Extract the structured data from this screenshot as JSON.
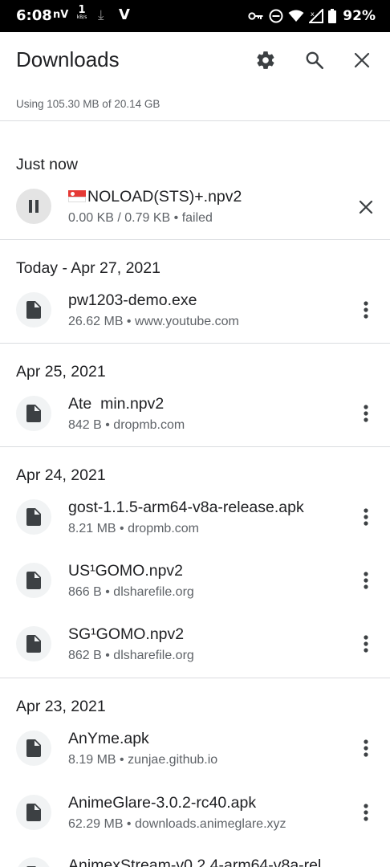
{
  "status_bar": {
    "time": "6:08",
    "carrier": "nV",
    "speed_value": "1",
    "speed_unit": "kB/s",
    "battery": "92%",
    "icons": [
      "download-icon",
      "vpn-v-icon",
      "key-icon",
      "dnd-icon",
      "wifi-icon",
      "signal-icon",
      "battery-icon"
    ]
  },
  "app_bar": {
    "title": "Downloads",
    "icons": [
      "settings-icon",
      "search-icon",
      "close-icon"
    ]
  },
  "storage": "Using 105.30 MB of 20.14 GB",
  "sections": [
    {
      "header": "Just now",
      "items": [
        {
          "name": "NOLOAD(STS)+.npv2",
          "meta": "0.00 KB / 0.79 KB • failed",
          "flag": "singapore-flag"
        }
      ]
    },
    {
      "header": "Today - Apr 27, 2021",
      "items": [
        {
          "name": "pw1203-demo.exe",
          "meta": "26.62 MB • www.youtube.com"
        }
      ]
    },
    {
      "header": "Apr 25, 2021",
      "items": [
        {
          "name": "Ate  min.npv2",
          "meta": "842 B • dropmb.com"
        }
      ]
    },
    {
      "header": "Apr 24, 2021",
      "items": [
        {
          "name": "gost-1.1.5-arm64-v8a-release.apk",
          "meta": "8.21 MB • dropmb.com"
        },
        {
          "name": "US¹GOMO.npv2",
          "meta": "866 B • dlsharefile.org"
        },
        {
          "name": "SG¹GOMO.npv2",
          "meta": "862 B • dlsharefile.org"
        }
      ]
    },
    {
      "header": "Apr 23, 2021",
      "items": [
        {
          "name": "AnYme.apk",
          "meta": "8.19 MB • zunjae.github.io"
        },
        {
          "name": "AnimeGlare-3.0.2-rc40.apk",
          "meta": "62.29 MB • downloads.animeglare.xyz"
        },
        {
          "name": "AnimexStream-v0.2.4-arm64-v8a-rel",
          "meta": ""
        }
      ]
    }
  ],
  "colors": {
    "text_primary": "#202124",
    "text_secondary": "#5f6368",
    "divider": "#dadce0",
    "icon_bg": "#f1f3f4"
  }
}
